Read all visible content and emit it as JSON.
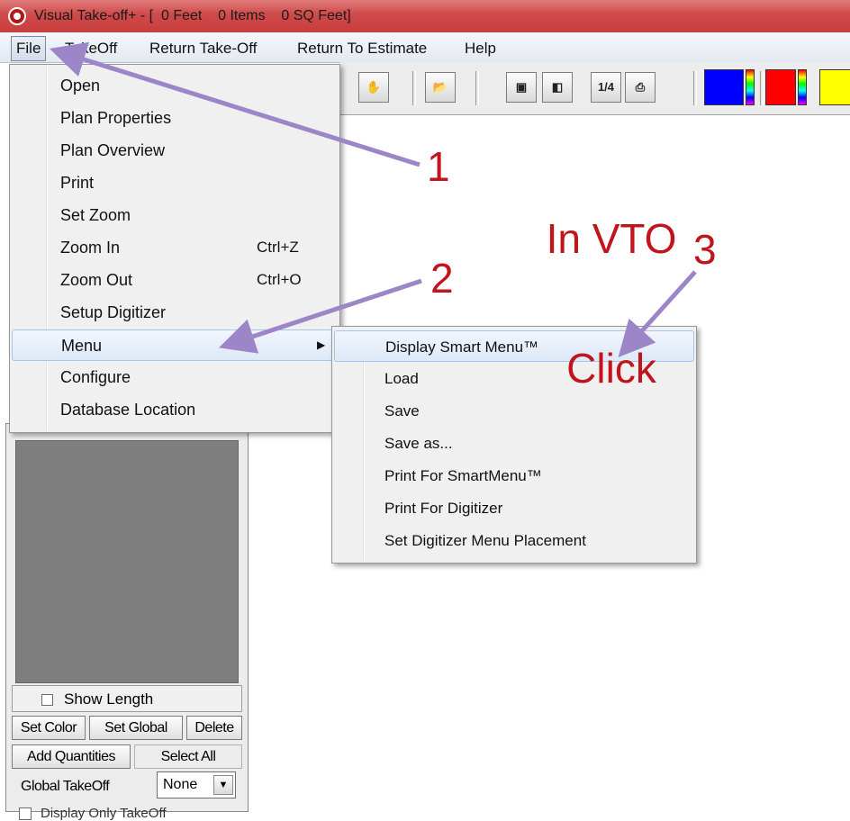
{
  "window": {
    "title": "Visual Take-off+ - [  0 Feet    0 Items    0 SQ Feet]"
  },
  "menubar": {
    "items": [
      "File",
      "TakeOff",
      "Return Take-Off",
      "Return To Estimate",
      "Help"
    ]
  },
  "file_menu": {
    "items": [
      {
        "label": "Open",
        "shortcut": ""
      },
      {
        "label": "Plan Properties",
        "shortcut": ""
      },
      {
        "label": "Plan Overview",
        "shortcut": ""
      },
      {
        "label": "Print",
        "shortcut": ""
      },
      {
        "label": "Set Zoom",
        "shortcut": ""
      },
      {
        "label": "Zoom In",
        "shortcut": "Ctrl+Z"
      },
      {
        "label": "Zoom Out",
        "shortcut": "Ctrl+O"
      },
      {
        "label": "Setup Digitizer",
        "shortcut": ""
      },
      {
        "label": "Menu",
        "shortcut": "",
        "has_submenu": true,
        "highlighted": true
      },
      {
        "label": "Configure",
        "shortcut": ""
      },
      {
        "label": "Database Location",
        "shortcut": ""
      }
    ]
  },
  "menu_submenu": {
    "items": [
      {
        "label": "Display Smart Menu™",
        "highlighted": true
      },
      {
        "label": "Load"
      },
      {
        "label": "Save"
      },
      {
        "label": "Save as..."
      },
      {
        "label": "Print For SmartMenu™"
      },
      {
        "label": "Print For Digitizer"
      },
      {
        "label": "Set Digitizer Menu Placement"
      }
    ]
  },
  "toolbar": {
    "buttons": [
      "hand-icon",
      "open-folder-icon",
      "zoom-fit-icon",
      "zoom-window-icon",
      "scale-icon",
      "printer-icon"
    ],
    "scale_label": "1/4",
    "colors": [
      "#0000ff",
      "#ff0000",
      "#ffff00"
    ]
  },
  "left_panel": {
    "show_length_label": "Show Length",
    "buttons": {
      "set_color": "Set Color",
      "set_global": "Set Global",
      "delete": "Delete",
      "add_quantities": "Add Quantities",
      "select_all": "Select All"
    },
    "global_takeoff_label": "Global TakeOff",
    "global_takeoff_value": "None",
    "display_only_label": "Display Only TakeOff"
  },
  "annotations": {
    "heading_line1": "In VTO",
    "heading_line2": "Click",
    "step1": "1",
    "step2": "2",
    "step3": "3",
    "arrow_color": "#9c86c7",
    "text_color": "#c1141c"
  }
}
